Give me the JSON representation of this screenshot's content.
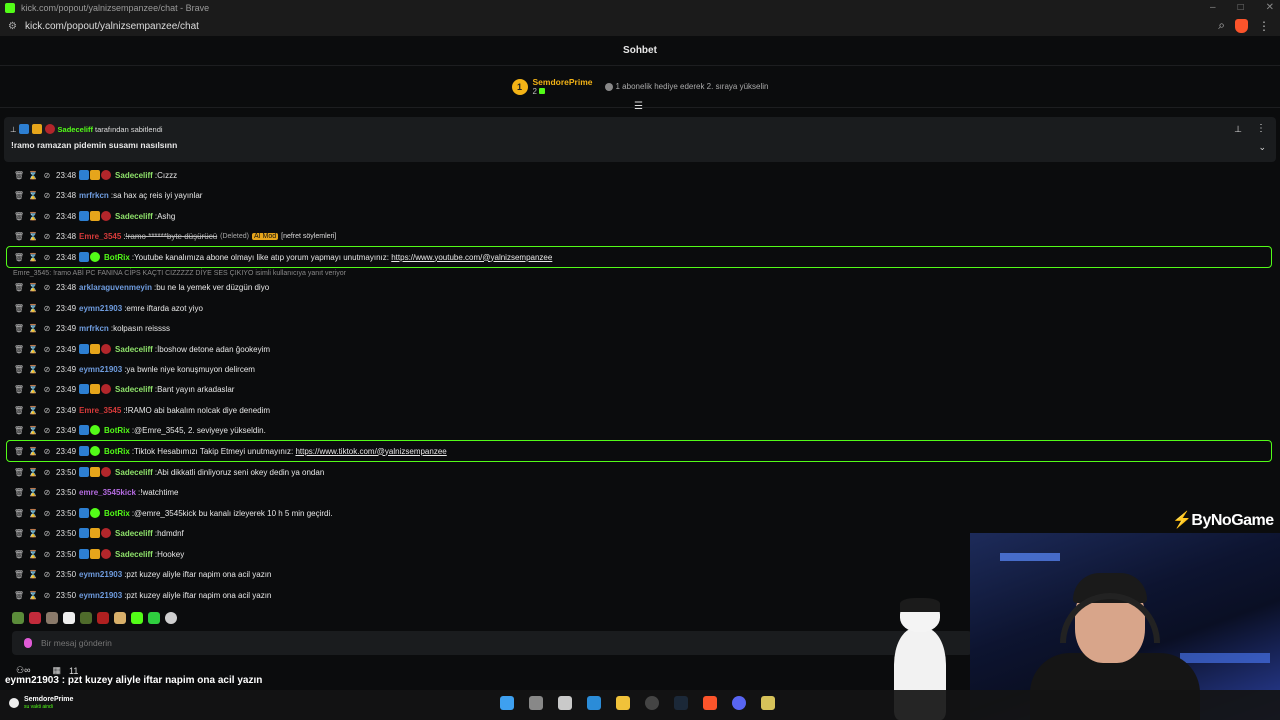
{
  "browser": {
    "title": "kick.com/popout/yalnizsempanzee/chat - Brave",
    "url": "kick.com/popout/yalnizsempanzee/chat"
  },
  "header": {
    "title": "Sohbet"
  },
  "leaderboard": {
    "rank": "1",
    "name": "SemdorePrime",
    "count": "2",
    "gift_text": "1 abonelik hediye ederek 2. sıraya yükselin"
  },
  "pinned": {
    "by_user": "Sadeceliff",
    "by_suffix": "tarafından sabitlendi",
    "message": "!ramo ramazan pidemin susamı nasılsınn"
  },
  "messages": [
    {
      "time": "23:48",
      "user": "Sadeceliff",
      "color": "#8fe36b",
      "badges": [
        "blue",
        "gold",
        "red"
      ],
      "text": "Cızzz"
    },
    {
      "time": "23:48",
      "user": "mrfrkcn",
      "color": "#6f9de0",
      "badges": [],
      "text": "sa hax aç reis iyi yayınlar"
    },
    {
      "time": "23:48",
      "user": "Sadeceliff",
      "color": "#8fe36b",
      "badges": [
        "blue",
        "gold",
        "red"
      ],
      "text": "Ashg"
    },
    {
      "time": "23:48",
      "user": "Emre_3545",
      "color": "#d63a3a",
      "badges": [],
      "text": "!ramo ******byte düşürücü",
      "deleted": "(Deleted)",
      "aimod": "AI Mod",
      "reason": "[nefret söylemleri]"
    },
    {
      "time": "23:48",
      "user": "BotRix",
      "color": "#53fc18",
      "badges": [
        "blue",
        "green"
      ],
      "text": "Youtube kanalımıza abone olmayı like atıp yorum yapmayı unutmayınız: ",
      "link": "https://www.youtube.com/@yalnizsempanzee",
      "highlight": true
    },
    {
      "time": "23:48",
      "user": "arklaraguvenmeyin",
      "color": "#6f9de0",
      "badges": [],
      "text": "bu ne la yemek ver düzgün diyo"
    },
    {
      "time": "23:49",
      "user": "eymn21903",
      "color": "#6f9de0",
      "badges": [],
      "text": "emre iftarda azot yiyo"
    },
    {
      "time": "23:49",
      "user": "mrfrkcn",
      "color": "#6f9de0",
      "badges": [],
      "text": "kolpasın reissss"
    },
    {
      "time": "23:49",
      "user": "Sadeceliff",
      "color": "#8fe36b",
      "badges": [
        "blue",
        "gold",
        "red"
      ],
      "text": "İboshow detone adan ğookeyim"
    },
    {
      "time": "23:49",
      "user": "eymn21903",
      "color": "#6f9de0",
      "badges": [],
      "text": "ya bwnle niye konuşmuyon delircem"
    },
    {
      "time": "23:49",
      "user": "Sadeceliff",
      "color": "#8fe36b",
      "badges": [
        "blue",
        "gold",
        "red"
      ],
      "text": "Bant yayın arkadaslar"
    },
    {
      "time": "23:49",
      "user": "Emre_3545",
      "color": "#d63a3a",
      "badges": [],
      "text": "!RAMO abi bakalım nolcak diye denedim"
    },
    {
      "time": "23:49",
      "user": "BotRix",
      "color": "#53fc18",
      "badges": [
        "blue",
        "green"
      ],
      "text": "@Emre_3545, 2. seviyeye yükseldin."
    },
    {
      "time": "23:49",
      "user": "BotRix",
      "color": "#53fc18",
      "badges": [
        "blue",
        "green"
      ],
      "text": "Tiktok Hesabımızı Takip Etmeyi unutmayınız: ",
      "link": "https://www.tiktok.com/@yalnizsempanzee",
      "highlight": true
    },
    {
      "time": "23:50",
      "user": "Sadeceliff",
      "color": "#8fe36b",
      "badges": [
        "blue",
        "gold",
        "red"
      ],
      "text": "Abi dikkatli dinliyoruz seni okey dedin ya ondan"
    },
    {
      "time": "23:50",
      "user": "emre_3545kick",
      "color": "#b46be0",
      "badges": [],
      "text": "!watchtime"
    },
    {
      "time": "23:50",
      "user": "BotRix",
      "color": "#53fc18",
      "badges": [
        "blue",
        "green"
      ],
      "text": "@emre_3545kick bu kanalı izleyerek 10 h 5 min geçirdi."
    },
    {
      "time": "23:50",
      "user": "Sadeceliff",
      "color": "#8fe36b",
      "badges": [
        "blue",
        "gold",
        "red"
      ],
      "text": "hdmdnf"
    },
    {
      "time": "23:50",
      "user": "Sadeceliff",
      "color": "#8fe36b",
      "badges": [
        "blue",
        "gold",
        "red"
      ],
      "text": "Hookey"
    },
    {
      "time": "23:50",
      "user": "eymn21903",
      "color": "#6f9de0",
      "badges": [],
      "text": "pzt kuzey aliyle iftar napim ona acil yazın"
    },
    {
      "time": "23:50",
      "user": "eymn21903",
      "color": "#6f9de0",
      "badges": [],
      "text": "pzt kuzey aliyle iftar napim ona acil yazın"
    }
  ],
  "reply_notice": "Emre_3545: !ramo ABİ PC FANINA CİPS KAÇTI CIZZZZZ DİYE SES ÇIKIYO isimli kullanıcıya yanıt veriyor",
  "input": {
    "placeholder": "Bir mesaj gönderin"
  },
  "bottom": {
    "viewers": "11"
  },
  "overlay_message": "eymn21903 : pzt kuzey aliyle iftar napim ona acil yazın",
  "brand": "ByNoGame",
  "taskbar": {
    "account": "SemdorePrime",
    "status": "su vakti aindi"
  }
}
